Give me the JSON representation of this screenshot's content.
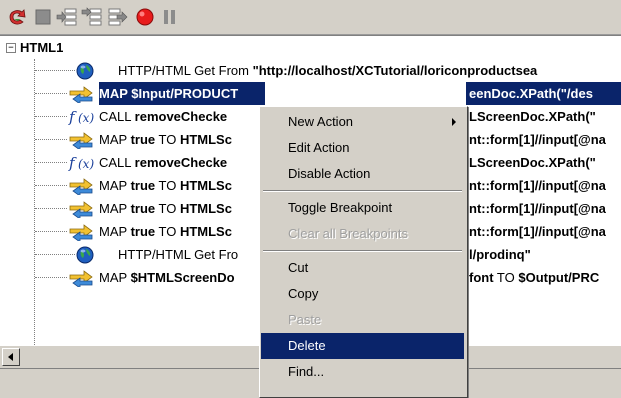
{
  "toolbar": {
    "buttons": [
      "run-icon",
      "stop-icon",
      "step-into-icon",
      "step-over-icon",
      "step-out-icon",
      "breakpoint-icon",
      "pause-icon"
    ],
    "colors": {
      "run": "#d23030",
      "breakpoint": "#e81c1c"
    }
  },
  "tree": {
    "root_label": "HTML1",
    "rows": [
      {
        "kind": "http",
        "parts": [
          {
            "t": "HTTP/HTML Get From ",
            "b": false
          },
          {
            "t": "\"http://localhost/XCTutorial/loriconproductsea",
            "b": true
          }
        ]
      },
      {
        "kind": "map",
        "selected": true,
        "parts": [
          {
            "t": "MAP $Input/PRODUCT",
            "b": true
          }
        ]
      },
      {
        "kind": "fx",
        "parts": [
          {
            "t": "CALL ",
            "b": false
          },
          {
            "t": "removeChecke",
            "b": true
          }
        ]
      },
      {
        "kind": "map",
        "parts": [
          {
            "t": "MAP ",
            "b": false
          },
          {
            "t": "true",
            "b": true
          },
          {
            "t": " TO ",
            "b": false
          },
          {
            "t": "HTMLSc",
            "b": true
          }
        ]
      },
      {
        "kind": "fx",
        "parts": [
          {
            "t": "CALL ",
            "b": false
          },
          {
            "t": "removeChecke",
            "b": true
          }
        ]
      },
      {
        "kind": "map",
        "parts": [
          {
            "t": "MAP ",
            "b": false
          },
          {
            "t": "true",
            "b": true
          },
          {
            "t": " TO ",
            "b": false
          },
          {
            "t": "HTMLSc",
            "b": true
          }
        ]
      },
      {
        "kind": "map",
        "parts": [
          {
            "t": "MAP ",
            "b": false
          },
          {
            "t": "true",
            "b": true
          },
          {
            "t": " TO ",
            "b": false
          },
          {
            "t": "HTMLSc",
            "b": true
          }
        ]
      },
      {
        "kind": "map",
        "parts": [
          {
            "t": "MAP ",
            "b": false
          },
          {
            "t": "true",
            "b": true
          },
          {
            "t": " TO ",
            "b": false
          },
          {
            "t": "HTMLSc",
            "b": true
          }
        ]
      },
      {
        "kind": "http",
        "parts": [
          {
            "t": "HTTP/HTML Get Fro",
            "b": false
          }
        ]
      },
      {
        "kind": "map",
        "parts": [
          {
            "t": "MAP ",
            "b": false
          },
          {
            "t": "$HTMLScreenDo",
            "b": true
          }
        ]
      }
    ],
    "right_fragments": [
      {
        "row": 1,
        "parts": [
          {
            "t": "eenDoc.XPath(\"/des",
            "b": true
          }
        ]
      },
      {
        "row": 2,
        "parts": [
          {
            "t": "LScreenDoc.XPath(\"",
            "b": true
          }
        ]
      },
      {
        "row": 3,
        "parts": [
          {
            "t": "nt::form[1]//input[@na",
            "b": true
          }
        ]
      },
      {
        "row": 4,
        "parts": [
          {
            "t": "LScreenDoc.XPath(\"",
            "b": true
          }
        ]
      },
      {
        "row": 5,
        "parts": [
          {
            "t": "nt::form[1]//input[@na",
            "b": true
          }
        ]
      },
      {
        "row": 6,
        "parts": [
          {
            "t": "nt::form[1]//input[@na",
            "b": true
          }
        ]
      },
      {
        "row": 7,
        "parts": [
          {
            "t": "nt::form[1]//input[@na",
            "b": true
          }
        ]
      },
      {
        "row": 8,
        "parts": [
          {
            "t": "l/prodinq\"",
            "b": true
          }
        ]
      },
      {
        "row": 9,
        "parts": [
          {
            "t": "font",
            "b": true
          },
          {
            "t": " TO ",
            "b": false
          },
          {
            "t": "$Output/PRC",
            "b": true
          }
        ]
      }
    ]
  },
  "context_menu": {
    "items": [
      {
        "label": "New Action",
        "enabled": true,
        "submenu": true
      },
      {
        "label": "Edit Action",
        "enabled": true
      },
      {
        "label": "Disable Action",
        "enabled": true
      },
      {
        "sep": true
      },
      {
        "label": "Toggle Breakpoint",
        "enabled": true
      },
      {
        "label": "Clear all Breakpoints",
        "enabled": false
      },
      {
        "sep": true
      },
      {
        "label": "Cut",
        "enabled": true
      },
      {
        "label": "Copy",
        "enabled": true
      },
      {
        "label": "Paste",
        "enabled": false
      },
      {
        "label": "Delete",
        "enabled": true,
        "highlighted": true
      },
      {
        "label": "Find...",
        "enabled": true
      }
    ]
  }
}
